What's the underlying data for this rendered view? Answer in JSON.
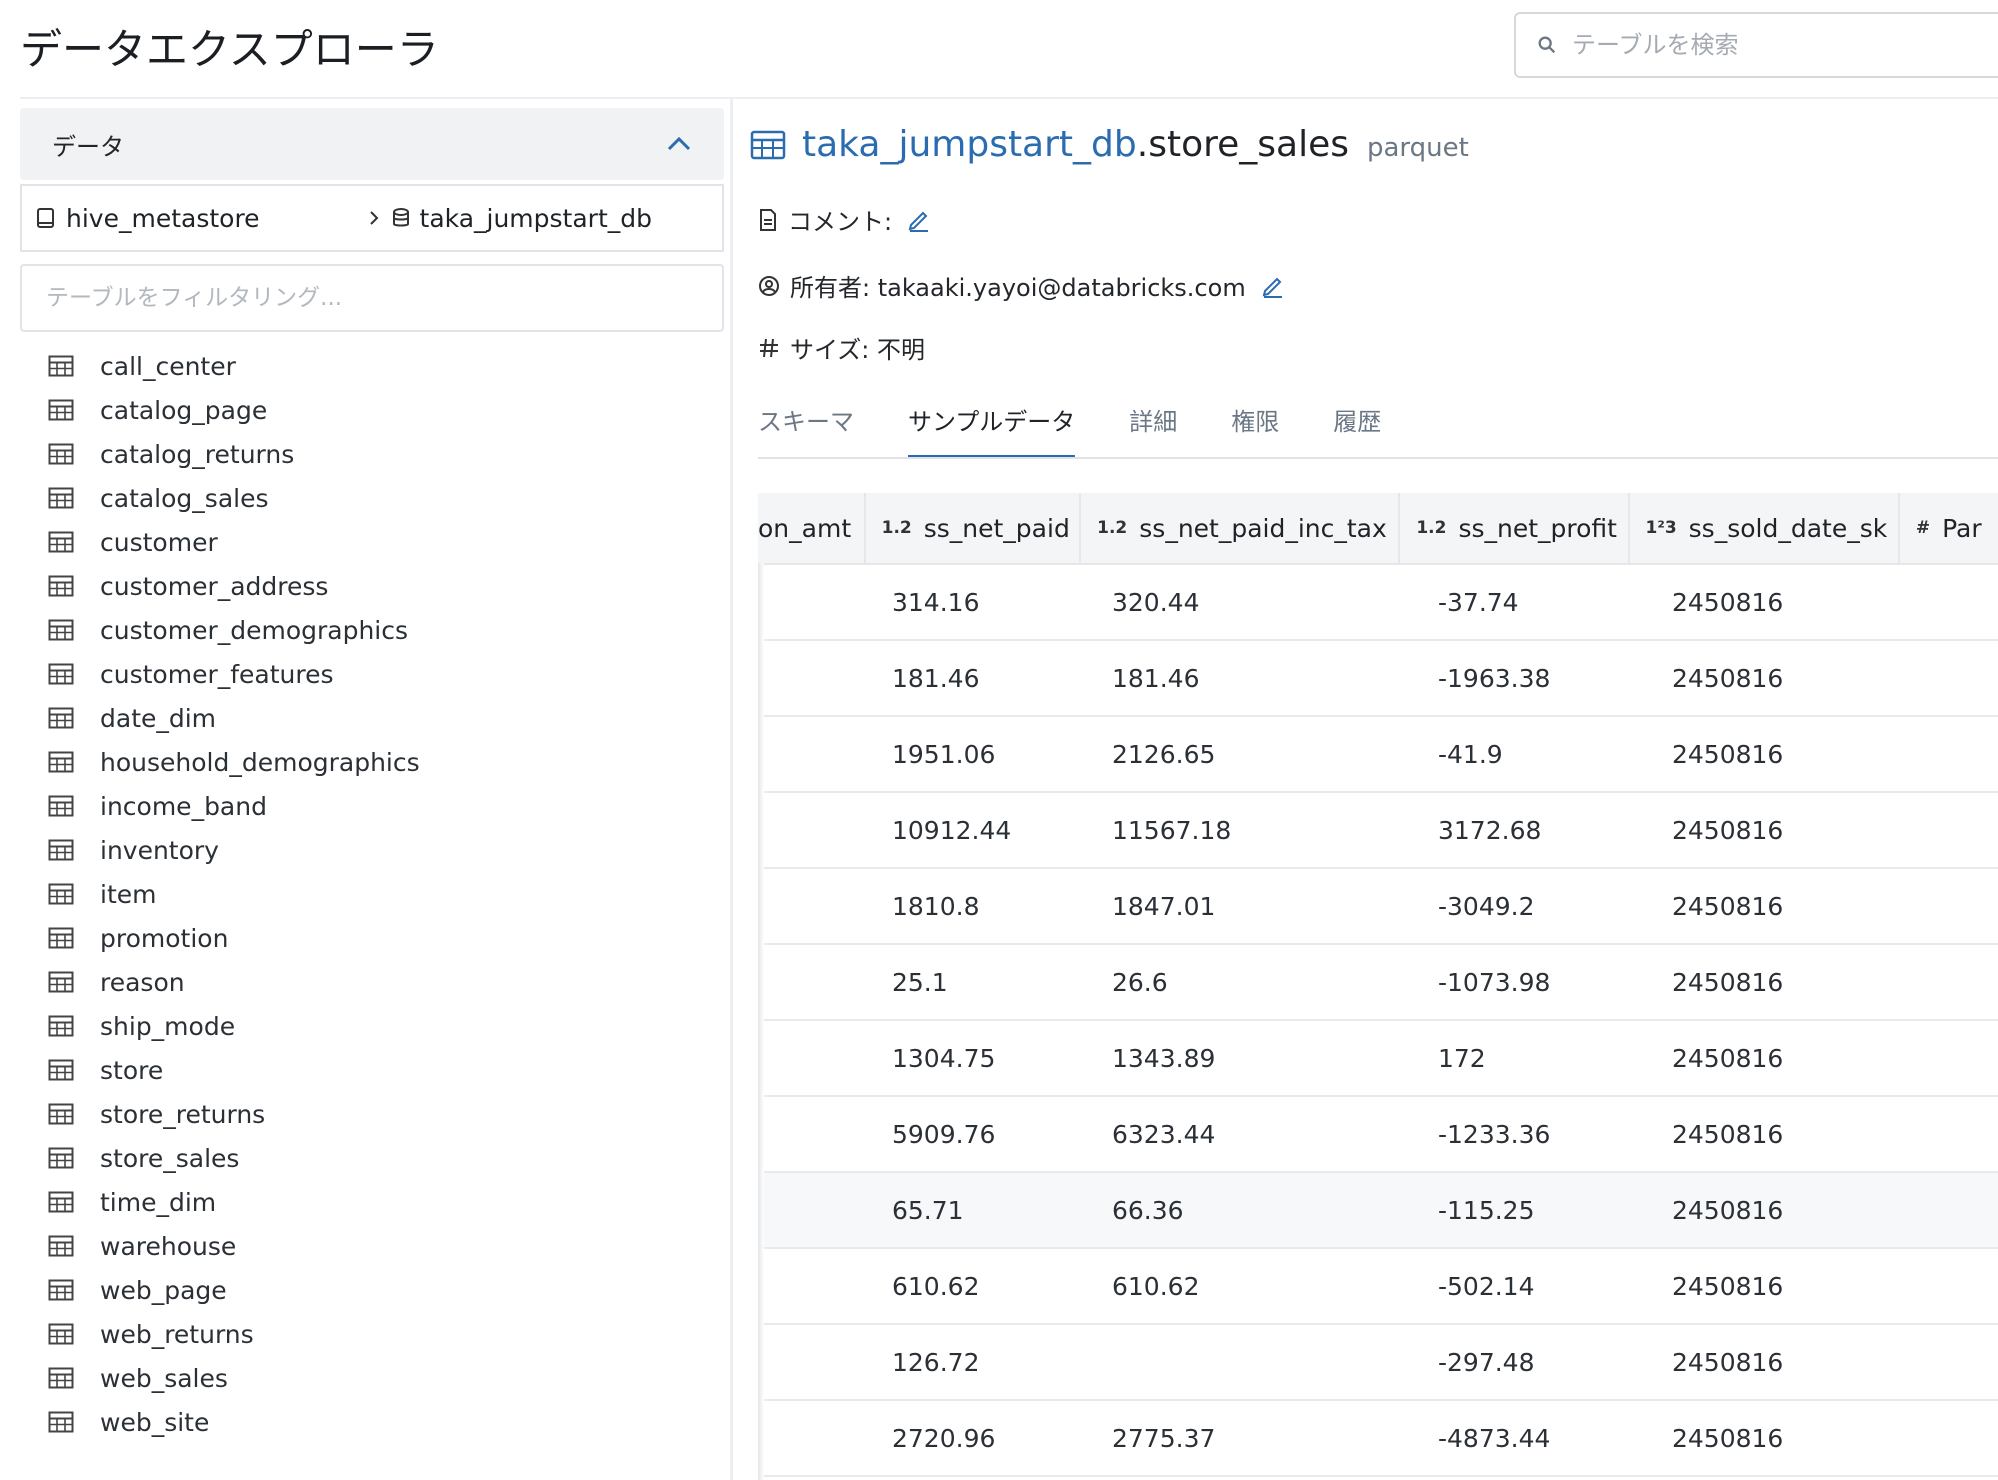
{
  "app": {
    "title": "データエクスプローラ"
  },
  "search": {
    "placeholder": "テーブルを検索"
  },
  "sidebar": {
    "section_label": "データ",
    "breadcrumb": {
      "catalog": "hive_metastore",
      "database": "taka_jumpstart_db"
    },
    "filter_placeholder": "テーブルをフィルタリング...",
    "tables": [
      "call_center",
      "catalog_page",
      "catalog_returns",
      "catalog_sales",
      "customer",
      "customer_address",
      "customer_demographics",
      "customer_features",
      "date_dim",
      "household_demographics",
      "income_band",
      "inventory",
      "item",
      "promotion",
      "reason",
      "ship_mode",
      "store",
      "store_returns",
      "store_sales",
      "time_dim",
      "warehouse",
      "web_page",
      "web_returns",
      "web_sales",
      "web_site"
    ]
  },
  "detail": {
    "db": "taka_jumpstart_db",
    "table": ".store_sales",
    "format": "parquet",
    "comment_label": "コメント:",
    "owner_label": "所有者: takaaki.yayoi@databricks.com",
    "size_label": "サイズ: 不明",
    "tabs": [
      "スキーマ",
      "サンプルデータ",
      "詳細",
      "権限",
      "履歴"
    ],
    "active_tab": "サンプルデータ"
  },
  "sample_table": {
    "columns": [
      {
        "type": "",
        "name": "on_amt"
      },
      {
        "type": "1.2",
        "name": "ss_net_paid"
      },
      {
        "type": "1.2",
        "name": "ss_net_paid_inc_tax"
      },
      {
        "type": "1.2",
        "name": "ss_net_profit"
      },
      {
        "type": "1²3",
        "name": "ss_sold_date_sk"
      },
      {
        "type": "#",
        "name": "Par"
      }
    ],
    "rows": [
      [
        "",
        "314.16",
        "320.44",
        "-37.74",
        "2450816"
      ],
      [
        "",
        "181.46",
        "181.46",
        "-1963.38",
        "2450816"
      ],
      [
        "",
        "1951.06",
        "2126.65",
        "-41.9",
        "2450816"
      ],
      [
        "",
        "10912.44",
        "11567.18",
        "3172.68",
        "2450816"
      ],
      [
        "",
        "1810.8",
        "1847.01",
        "-3049.2",
        "2450816"
      ],
      [
        "",
        "25.1",
        "26.6",
        "-1073.98",
        "2450816"
      ],
      [
        "",
        "1304.75",
        "1343.89",
        "172",
        "2450816"
      ],
      [
        "",
        "5909.76",
        "6323.44",
        "-1233.36",
        "2450816"
      ],
      [
        "",
        "65.71",
        "66.36",
        "-115.25",
        "2450816"
      ],
      [
        "",
        "610.62",
        "610.62",
        "-502.14",
        "2450816"
      ],
      [
        "",
        "126.72",
        "",
        "-297.48",
        "2450816"
      ],
      [
        "",
        "2720.96",
        "2775.37",
        "-4873.44",
        "2450816"
      ]
    ]
  },
  "colors": {
    "accent": "#2b6cb0",
    "text": "#1f2328",
    "muted": "#6b7785"
  }
}
